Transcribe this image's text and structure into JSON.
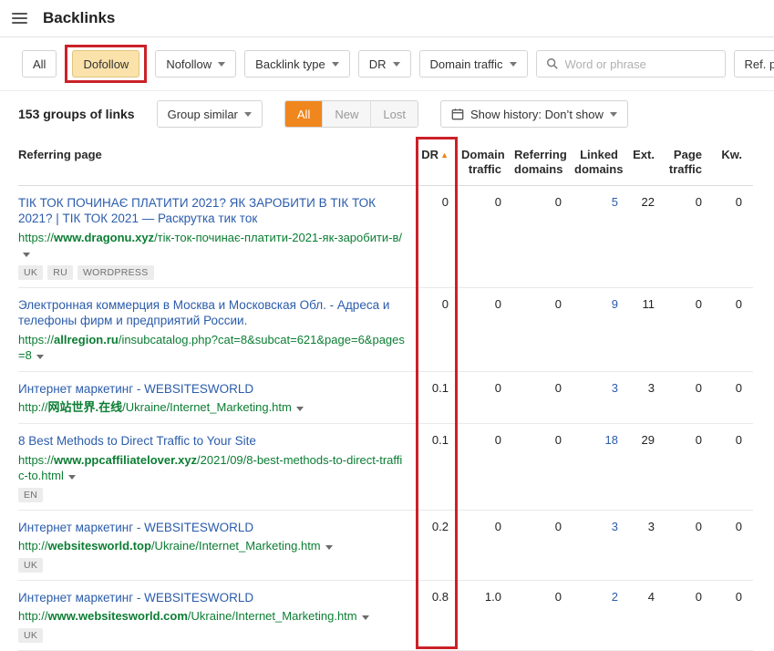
{
  "icons": {
    "sort_asc": "▲"
  },
  "annotations": {
    "color": "#cb2128"
  },
  "header": {
    "title": "Backlinks"
  },
  "filters": {
    "all_label": "All",
    "dofollow_label": "Dofollow",
    "nofollow_label": "Nofollow",
    "backlink_type_label": "Backlink type",
    "dr_label": "DR",
    "domain_traffic_label": "Domain traffic",
    "search_placeholder": "Word or phrase",
    "ref_page_label": "Ref. page URL"
  },
  "toolbar": {
    "groups_count": "153 groups of links",
    "group_similar_label": "Group similar",
    "segment_all": "All",
    "segment_new": "New",
    "segment_lost": "Lost",
    "show_history_label": "Show history: Don’t show"
  },
  "table": {
    "columns": {
      "referring_page": "Referring page",
      "dr": "DR",
      "domain_traffic": "Domain traffic",
      "referring_domains": "Referring domains",
      "linked_domains": "Linked domains",
      "ext": "Ext.",
      "page_traffic": "Page traffic",
      "kw": "Kw."
    },
    "rows": [
      {
        "title": "ТІК ТОК ПОЧИНАЄ ПЛАТИТИ 2021? ЯК ЗАРОБИТИ В ТІК ТОК 2021? | ТІК ТОК 2021 — Раскрутка тик ток",
        "url_prefix": "https://",
        "url_domain": "www.dragonu.xyz",
        "url_path": "/тік-ток-починає-платити-2021-як-заробити-в/",
        "badges": [
          "UK",
          "RU",
          "WORDPRESS"
        ],
        "dr": "0",
        "domain_traffic": "0",
        "referring_domains": "0",
        "linked_domains": "5",
        "ext": "22",
        "page_traffic": "0",
        "kw": "0"
      },
      {
        "title": "Электронная коммерция в Москва и Московская Обл. - Адреса и телефоны фирм и предприятий России.",
        "url_prefix": "https://",
        "url_domain": "allregion.ru",
        "url_path": "/insubcatalog.php?cat=8&subcat=621&page=6&pages=8",
        "badges": [],
        "dr": "0",
        "domain_traffic": "0",
        "referring_domains": "0",
        "linked_domains": "9",
        "ext": "11",
        "page_traffic": "0",
        "kw": "0"
      },
      {
        "title": "Интернет маркетинг - WEBSITESWORLD",
        "url_prefix": "http://",
        "url_domain": "网站世界.在线",
        "url_path": "/Ukraine/Internet_Marketing.htm",
        "badges": [],
        "dr": "0.1",
        "domain_traffic": "0",
        "referring_domains": "0",
        "linked_domains": "3",
        "ext": "3",
        "page_traffic": "0",
        "kw": "0"
      },
      {
        "title": "8 Best Methods to Direct Traffic to Your Site",
        "url_prefix": "https://",
        "url_domain": "www.ppcaffiliatelover.xyz",
        "url_path": "/2021/09/8-best-methods-to-direct-traffic-to.html",
        "badges": [
          "EN"
        ],
        "dr": "0.1",
        "domain_traffic": "0",
        "referring_domains": "0",
        "linked_domains": "18",
        "ext": "29",
        "page_traffic": "0",
        "kw": "0"
      },
      {
        "title": "Интернет маркетинг - WEBSITESWORLD",
        "url_prefix": "http://",
        "url_domain": "websitesworld.top",
        "url_path": "/Ukraine/Internet_Marketing.htm",
        "badges": [
          "UK"
        ],
        "dr": "0.2",
        "domain_traffic": "0",
        "referring_domains": "0",
        "linked_domains": "3",
        "ext": "3",
        "page_traffic": "0",
        "kw": "0"
      },
      {
        "title": "Интернет маркетинг - WEBSITESWORLD",
        "url_prefix": "http://",
        "url_domain": "www.websitesworld.com",
        "url_path": "/Ukraine/Internet_Marketing.htm",
        "badges": [
          "UK"
        ],
        "dr": "0.8",
        "domain_traffic": "1.0",
        "referring_domains": "0",
        "linked_domains": "2",
        "ext": "4",
        "page_traffic": "0",
        "kw": "0"
      }
    ]
  }
}
